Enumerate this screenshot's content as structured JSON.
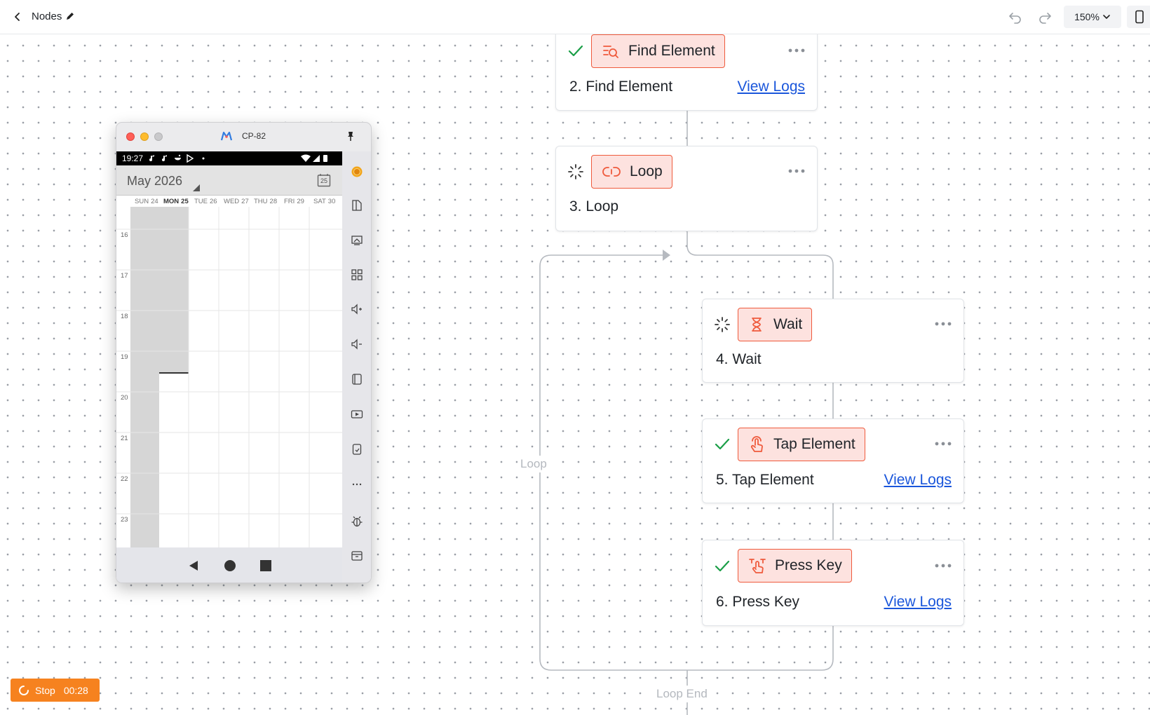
{
  "topbar": {
    "title": "Nodes",
    "back_icon": "chevron-left-icon",
    "edit_icon": "pencil-icon",
    "undo_icon": "undo-icon",
    "redo_icon": "redo-icon",
    "zoom": "150%",
    "device_toggle_icon": "phone-icon"
  },
  "flow": {
    "loop_label": "Loop",
    "loop_end_label": "Loop End",
    "nodes": [
      {
        "chip": "Find Element",
        "name": "2. Find Element",
        "status": "success",
        "icon": "find-element-icon",
        "logs": "View Logs"
      },
      {
        "chip": "Loop",
        "name": "3. Loop",
        "status": "running",
        "icon": "loop-icon"
      },
      {
        "chip": "Wait",
        "name": "4. Wait",
        "status": "running",
        "icon": "hourglass-icon"
      },
      {
        "chip": "Tap Element",
        "name": "5. Tap Element",
        "status": "success",
        "icon": "tap-icon",
        "logs": "View Logs"
      },
      {
        "chip": "Press Key",
        "name": "6. Press Key",
        "status": "success",
        "icon": "press-key-icon",
        "logs": "View Logs"
      }
    ]
  },
  "device": {
    "window_title": "CP-82",
    "status_time": "19:27",
    "calendar": {
      "month": "May 2026",
      "today_badge": "25",
      "days": [
        {
          "dow": "SUN",
          "num": "24"
        },
        {
          "dow": "MON",
          "num": "25"
        },
        {
          "dow": "TUE",
          "num": "26"
        },
        {
          "dow": "WED",
          "num": "27"
        },
        {
          "dow": "THU",
          "num": "28"
        },
        {
          "dow": "FRI",
          "num": "29"
        },
        {
          "dow": "SAT",
          "num": "30"
        }
      ],
      "hours": [
        "16",
        "17",
        "18",
        "19",
        "20",
        "21",
        "22",
        "23"
      ]
    },
    "tools": [
      "record-icon",
      "file-icon",
      "screen-share-icon",
      "grid-icon",
      "volume-up-icon",
      "volume-down-icon",
      "rotate-icon",
      "video-icon",
      "device-icon",
      "more-icon",
      "bug-icon",
      "archive-icon"
    ]
  },
  "run": {
    "stop_label": "Stop",
    "elapsed": "00:28"
  },
  "colors": {
    "accent": "#ef5a3c",
    "chip_bg": "#fde2df",
    "success": "#1a9e47",
    "link": "#1a56db",
    "stop": "#f6821f"
  }
}
